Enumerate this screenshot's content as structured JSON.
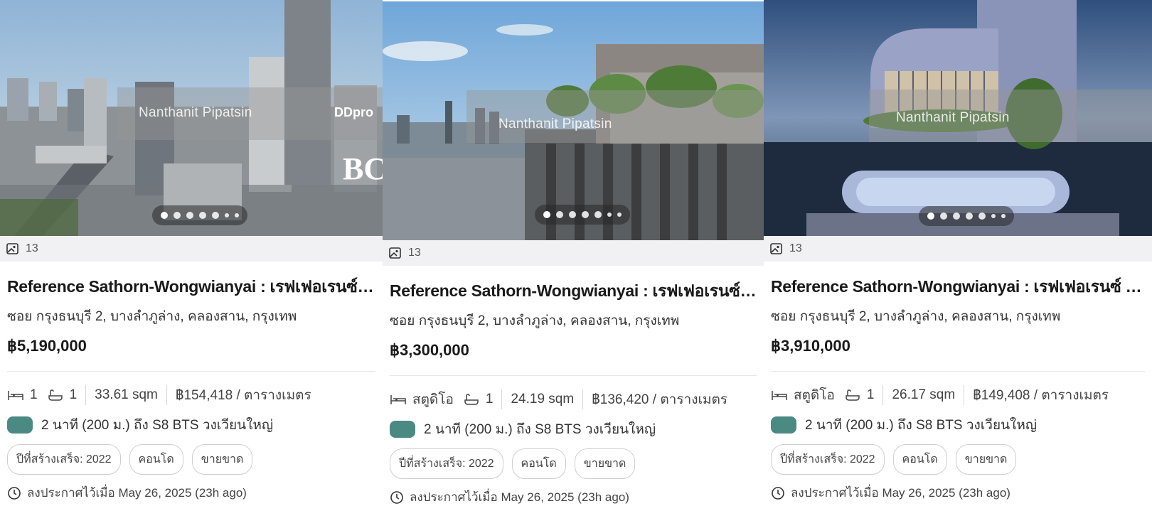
{
  "listings": [
    {
      "photo_count": "13",
      "watermark_name": "Nanthanit Pipatsin",
      "watermark_brand": "DDpro",
      "watermark_logo": "BC",
      "title": "Reference Sathorn-Wongwianyai : เรฟเฟอเรนซ์ สาทร-วงเวียนใหญ่",
      "address": "ซอย กรุงธนบุรี 2, บางลำภูล่าง, คลองสาน, กรุงเทพ",
      "price": "฿5,190,000",
      "bedrooms": "1",
      "bathrooms": "1",
      "area": "33.61 sqm",
      "price_per_area": "฿154,418 / ตารางเมตร",
      "transit": "2 นาที (200 ม.) ถึง S8 BTS วงเวียนใหญ่",
      "tags": [
        "ปีที่สร้างเสร็จ: 2022",
        "คอนโด",
        "ขายขาด"
      ],
      "posted": "ลงประกาศไว้เมื่อ May 26, 2025 (23h ago)"
    },
    {
      "photo_count": "13",
      "watermark_name": "Nanthanit Pipatsin",
      "watermark_brand": "",
      "watermark_logo": "",
      "title": "Reference Sathorn-Wongwianyai : เรฟเฟอเรนซ์ สาทร-วงเวียนใหญ่",
      "address": "ซอย กรุงธนบุรี 2, บางลำภูล่าง, คลองสาน, กรุงเทพ",
      "price": "฿3,300,000",
      "bedrooms": "สตูดิโอ",
      "bathrooms": "1",
      "area": "24.19 sqm",
      "price_per_area": "฿136,420 / ตารางเมตร",
      "transit": "2 นาที (200 ม.) ถึง S8 BTS วงเวียนใหญ่",
      "tags": [
        "ปีที่สร้างเสร็จ: 2022",
        "คอนโด",
        "ขายขาด"
      ],
      "posted": "ลงประกาศไว้เมื่อ May 26, 2025 (23h ago)"
    },
    {
      "photo_count": "13",
      "watermark_name": "Nanthanit Pipatsin",
      "watermark_brand": "",
      "watermark_logo": "",
      "title": "Reference Sathorn-Wongwianyai : เรฟเฟอเรนซ์ สาทร-วงเวียนใหญ่",
      "address": "ซอย กรุงธนบุรี 2, บางลำภูล่าง, คลองสาน, กรุงเทพ",
      "price": "฿3,910,000",
      "bedrooms": "สตูดิโอ",
      "bathrooms": "1",
      "area": "26.17 sqm",
      "price_per_area": "฿149,408 / ตารางเมตร",
      "transit": "2 นาที (200 ม.) ถึง S8 BTS วงเวียนใหญ่",
      "tags": [
        "ปีที่สร้างเสร็จ: 2022",
        "คอนโด",
        "ขายขาด"
      ],
      "posted": "ลงประกาศไว้เมื่อ May 26, 2025 (23h ago)"
    }
  ],
  "icons": {
    "gallery": "image-gallery-icon",
    "bed": "bed-icon",
    "bath": "bathtub-icon",
    "clock": "clock-icon",
    "transit": "bts-transit-icon"
  },
  "colors": {
    "transit_badge": "#4b8a82",
    "count_bar": "#f1f1f3"
  },
  "carousel": {
    "active_index": 0,
    "dot_count": 7
  }
}
